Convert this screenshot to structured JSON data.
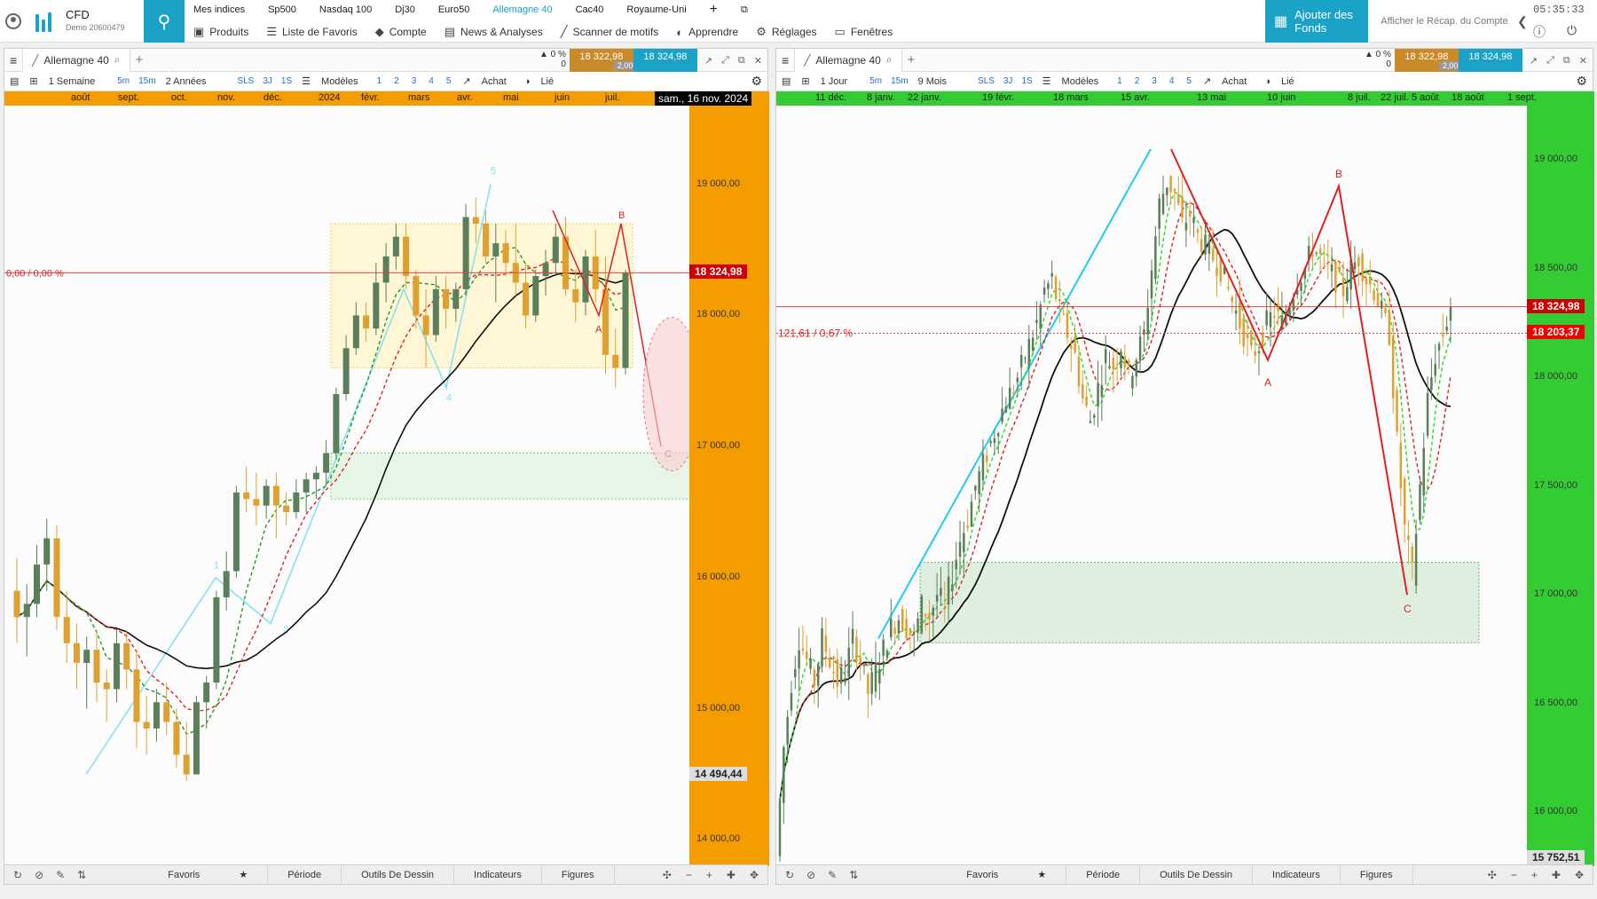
{
  "app": {
    "brand_title": "CFD",
    "brand_sub": "Demo 20600479",
    "clock": "05:35:33",
    "add_funds": "Ajouter des Fonds",
    "recap": "Afficher le Récap. du Compte"
  },
  "tickers": [
    "Mes indices",
    "Sp500",
    "Nasdaq 100",
    "Dj30",
    "Euro50",
    "Allemagne 40",
    "Cac40",
    "Royaume-Uni"
  ],
  "active_ticker": "Allemagne 40",
  "menu": [
    "Produits",
    "Liste de Favoris",
    "Compte",
    "News & Analyses",
    "Scanner de motifs",
    "Apprendre",
    "Réglages",
    "Fenêtres"
  ],
  "colors": {
    "accent": "#1aa2c7",
    "orange_axis": "#f59d00",
    "green_axis": "#33cc33",
    "bull": "#5a7f5a",
    "bear": "#e0a030",
    "red": "#cc0000"
  },
  "left": {
    "symbol": "Allemagne 40",
    "pct": "0 %",
    "pct_sub": "0",
    "sell": "18 322,98",
    "buy": "18 324,98",
    "spread": "2,00",
    "interval": "1 Semaine",
    "tf_buttons": [
      "5m",
      "15m"
    ],
    "range": "2 Années",
    "style_buttons": [
      "SLS",
      "3J",
      "1S"
    ],
    "models": "Modèles",
    "nums": [
      "1",
      "2",
      "3",
      "4",
      "5"
    ],
    "achat": "Achat",
    "lie": "Lié",
    "xlabels": [
      "août",
      "sept.",
      "oct.",
      "nov.",
      "déc.",
      "2024",
      "févr.",
      "mars",
      "avr.",
      "mai",
      "juin",
      "juil."
    ],
    "date_badge": "sam., 16 nov. 2024",
    "change_label": "0,00 / 0,00 %",
    "price_badge": "18 324,98",
    "low_badge": "14 494,44",
    "ylabels": [
      "19 000,00",
      "18 000,00",
      "17 000,00",
      "16 000,00",
      "15 000,00",
      "14 000,00"
    ],
    "wave_labels": [
      "1",
      "2",
      "3",
      "4",
      "5"
    ],
    "abc_labels": [
      "A",
      "B",
      "C"
    ],
    "footer": [
      "Favoris",
      "Période",
      "Outils De Dessin",
      "Indicateurs",
      "Figures"
    ]
  },
  "right": {
    "symbol": "Allemagne 40",
    "pct": "0 %",
    "pct_sub": "0",
    "sell": "18 322,98",
    "buy": "18 324,98",
    "spread": "2,00",
    "interval": "1 Jour",
    "tf_buttons": [
      "5m",
      "15m"
    ],
    "range": "9 Mois",
    "style_buttons": [
      "SLS",
      "3J",
      "1S"
    ],
    "models": "Modèles",
    "nums": [
      "1",
      "2",
      "3",
      "4",
      "5"
    ],
    "achat": "Achat",
    "lie": "Lié",
    "xlabels": [
      "11 déc.",
      "8 janv.",
      "22 janv.",
      "19 févr.",
      "18 mars",
      "15 avr.",
      "13 mai",
      "10 juin",
      "8 juil.",
      "22 juil.",
      "5 août",
      "18 août",
      "1 sept."
    ],
    "change_label": "121,61 / 0,67 %",
    "price_badge": "18 324,98",
    "price_badge2": "18 203,37",
    "low_badge": "15 752,51",
    "ylabels": [
      "19 000,00",
      "18 500,00",
      "18 000,00",
      "17 500,00",
      "17 000,00",
      "16 500,00",
      "16 000,00"
    ],
    "abc_labels": [
      "A",
      "B",
      "C"
    ],
    "footer": [
      "Favoris",
      "Période",
      "Outils De Dessin",
      "Indicateurs",
      "Figures"
    ]
  },
  "chart_data": [
    {
      "type": "candlestick",
      "title": "Allemagne 40",
      "timeframe": "1 Semaine",
      "ylim": [
        13800,
        19600
      ],
      "x": [
        "août",
        "sept.",
        "oct.",
        "nov.",
        "déc.",
        "2024",
        "févr.",
        "mars",
        "avr.",
        "mai",
        "juin",
        "juil."
      ],
      "ohlc": [
        [
          15900,
          16150,
          15500,
          15700
        ],
        [
          15700,
          15950,
          15400,
          15800
        ],
        [
          15800,
          16250,
          15700,
          16100
        ],
        [
          16100,
          16450,
          15900,
          16300
        ],
        [
          16300,
          16400,
          15600,
          15700
        ],
        [
          15700,
          15900,
          15350,
          15500
        ],
        [
          15500,
          15650,
          15150,
          15350
        ],
        [
          15350,
          15550,
          15000,
          15450
        ],
        [
          15450,
          15600,
          15050,
          15200
        ],
        [
          15200,
          15300,
          14900,
          15150
        ],
        [
          15150,
          15600,
          15050,
          15500
        ],
        [
          15500,
          15600,
          15150,
          15300
        ],
        [
          15300,
          15450,
          14700,
          14900
        ],
        [
          14900,
          15100,
          14650,
          14850
        ],
        [
          14850,
          15150,
          14750,
          15050
        ],
        [
          15050,
          15200,
          14800,
          14900
        ],
        [
          14900,
          15000,
          14550,
          14650
        ],
        [
          14650,
          14900,
          14450,
          14500
        ],
        [
          14500,
          15100,
          14500,
          15050
        ],
        [
          15050,
          15250,
          14850,
          15200
        ],
        [
          15200,
          15900,
          15150,
          15850
        ],
        [
          15850,
          16200,
          15750,
          16050
        ],
        [
          16050,
          16700,
          16000,
          16650
        ],
        [
          16650,
          16850,
          16500,
          16600
        ],
        [
          16600,
          16800,
          16400,
          16550
        ],
        [
          16550,
          16750,
          16450,
          16700
        ],
        [
          16700,
          16800,
          16300,
          16550
        ],
        [
          16550,
          16650,
          16400,
          16500
        ],
        [
          16500,
          16750,
          16450,
          16650
        ],
        [
          16650,
          16800,
          16500,
          16750
        ],
        [
          16750,
          16850,
          16600,
          16800
        ],
        [
          16800,
          17050,
          16700,
          16950
        ],
        [
          16950,
          17450,
          16900,
          17400
        ],
        [
          17400,
          17850,
          17350,
          17750
        ],
        [
          17750,
          18100,
          17700,
          18000
        ],
        [
          18000,
          18100,
          17800,
          17900
        ],
        [
          17900,
          18400,
          17850,
          18250
        ],
        [
          18250,
          18550,
          18100,
          18450
        ],
        [
          18450,
          18700,
          18350,
          18600
        ],
        [
          18600,
          18700,
          18200,
          18300
        ],
        [
          18300,
          18350,
          17900,
          18000
        ],
        [
          18000,
          18200,
          17600,
          17850
        ],
        [
          17850,
          18300,
          17800,
          18200
        ],
        [
          18200,
          18300,
          17900,
          18050
        ],
        [
          18050,
          18250,
          17950,
          18200
        ],
        [
          18200,
          18850,
          18150,
          18750
        ],
        [
          18750,
          18900,
          18550,
          18700
        ],
        [
          18700,
          18800,
          18400,
          18450
        ],
        [
          18450,
          18700,
          18100,
          18550
        ],
        [
          18550,
          18650,
          18300,
          18400
        ],
        [
          18400,
          18700,
          18150,
          18250
        ],
        [
          18250,
          18400,
          17900,
          18000
        ],
        [
          18000,
          18350,
          17950,
          18300
        ],
        [
          18300,
          18500,
          18150,
          18400
        ],
        [
          18400,
          18700,
          18300,
          18600
        ],
        [
          18600,
          18750,
          18150,
          18200
        ],
        [
          18200,
          18350,
          17950,
          18100
        ],
        [
          18100,
          18500,
          18000,
          18450
        ],
        [
          18450,
          18650,
          18100,
          18200
        ],
        [
          18200,
          18450,
          17550,
          17700
        ],
        [
          17700,
          17900,
          17450,
          17600
        ],
        [
          17600,
          18350,
          17550,
          18324.98
        ]
      ],
      "last": "18 324,98"
    },
    {
      "type": "candlestick",
      "title": "Allemagne 40",
      "timeframe": "1 Jour",
      "ylim": [
        15752.51,
        19250
      ],
      "x": [
        "11 déc.",
        "8 janv.",
        "22 janv.",
        "19 févr.",
        "18 mars",
        "15 avr.",
        "13 mai",
        "10 juin",
        "8 juil.",
        "22 juil.",
        "5 août",
        "18 août",
        "1 sept."
      ],
      "seed_path": [
        15800,
        16300,
        16600,
        16800,
        16700,
        16600,
        16800,
        16700,
        16600,
        16650,
        16800,
        16700,
        16550,
        16650,
        16750,
        16850,
        16900,
        16850,
        16800,
        16950,
        16900,
        17000,
        16950,
        17100,
        17250,
        17350,
        17500,
        17600,
        17700,
        17800,
        17900,
        17950,
        18050,
        18150,
        18250,
        18400,
        18450,
        18300,
        18200,
        18100,
        17900,
        17800,
        17950,
        18100,
        18050,
        18150,
        18000,
        18100,
        18200,
        18500,
        18800,
        18900,
        18850,
        18700,
        18750,
        18650,
        18600,
        18550,
        18500,
        18400,
        18300,
        18200,
        18100,
        18150,
        18250,
        18300,
        18250,
        18350,
        18450,
        18500,
        18600,
        18550,
        18500,
        18450,
        18400,
        18500,
        18550,
        18450,
        18400,
        18300,
        18200,
        17700,
        17300,
        17100,
        17500,
        17900,
        18100,
        18200,
        18324.98
      ],
      "last": "18 324,98",
      "prev_close": "18 203,37"
    }
  ]
}
